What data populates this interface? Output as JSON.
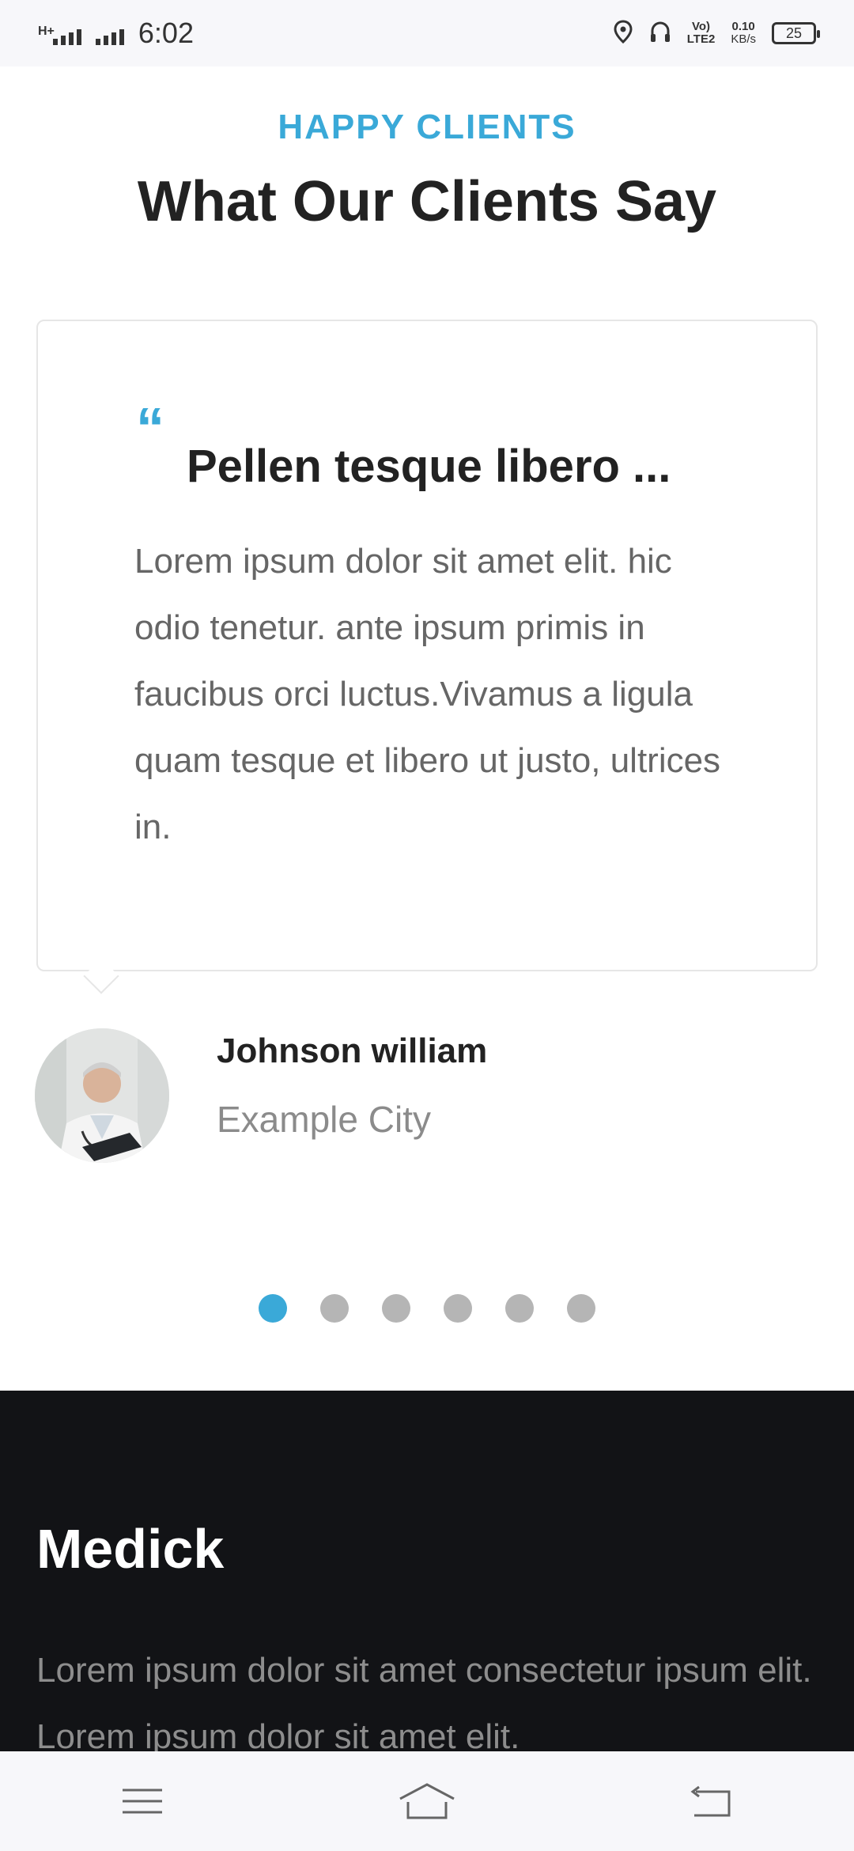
{
  "status_bar": {
    "network_type": "H+",
    "time": "6:02",
    "volte": "Vo)",
    "lte": "LTE2",
    "speed_value": "0.10",
    "speed_unit": "KB/s",
    "battery": "25"
  },
  "header": {
    "eyebrow": "HAPPY CLIENTS",
    "title": "What Our Clients Say"
  },
  "testimonial": {
    "quote_mark": "“",
    "title": "Pellen tesque libero ...",
    "body": "Lorem ipsum dolor sit amet elit. hic odio tenetur. ante ipsum primis in faucibus orci luctus.Vivamus a ligula quam tesque et libero ut justo, ultrices in.",
    "author_name": "Johnson william",
    "author_city": "Example City"
  },
  "pager": {
    "count": 6,
    "active_index": 0
  },
  "footer": {
    "title": "Medick",
    "text": "Lorem ipsum dolor sit amet consectetur ipsum elit. Lorem ipsum dolor sit amet elit."
  },
  "colors": {
    "accent": "#3aa9d8",
    "dark_footer": "#121316"
  },
  "icons": {
    "nav": [
      "menu-icon",
      "home-icon",
      "back-icon"
    ]
  }
}
